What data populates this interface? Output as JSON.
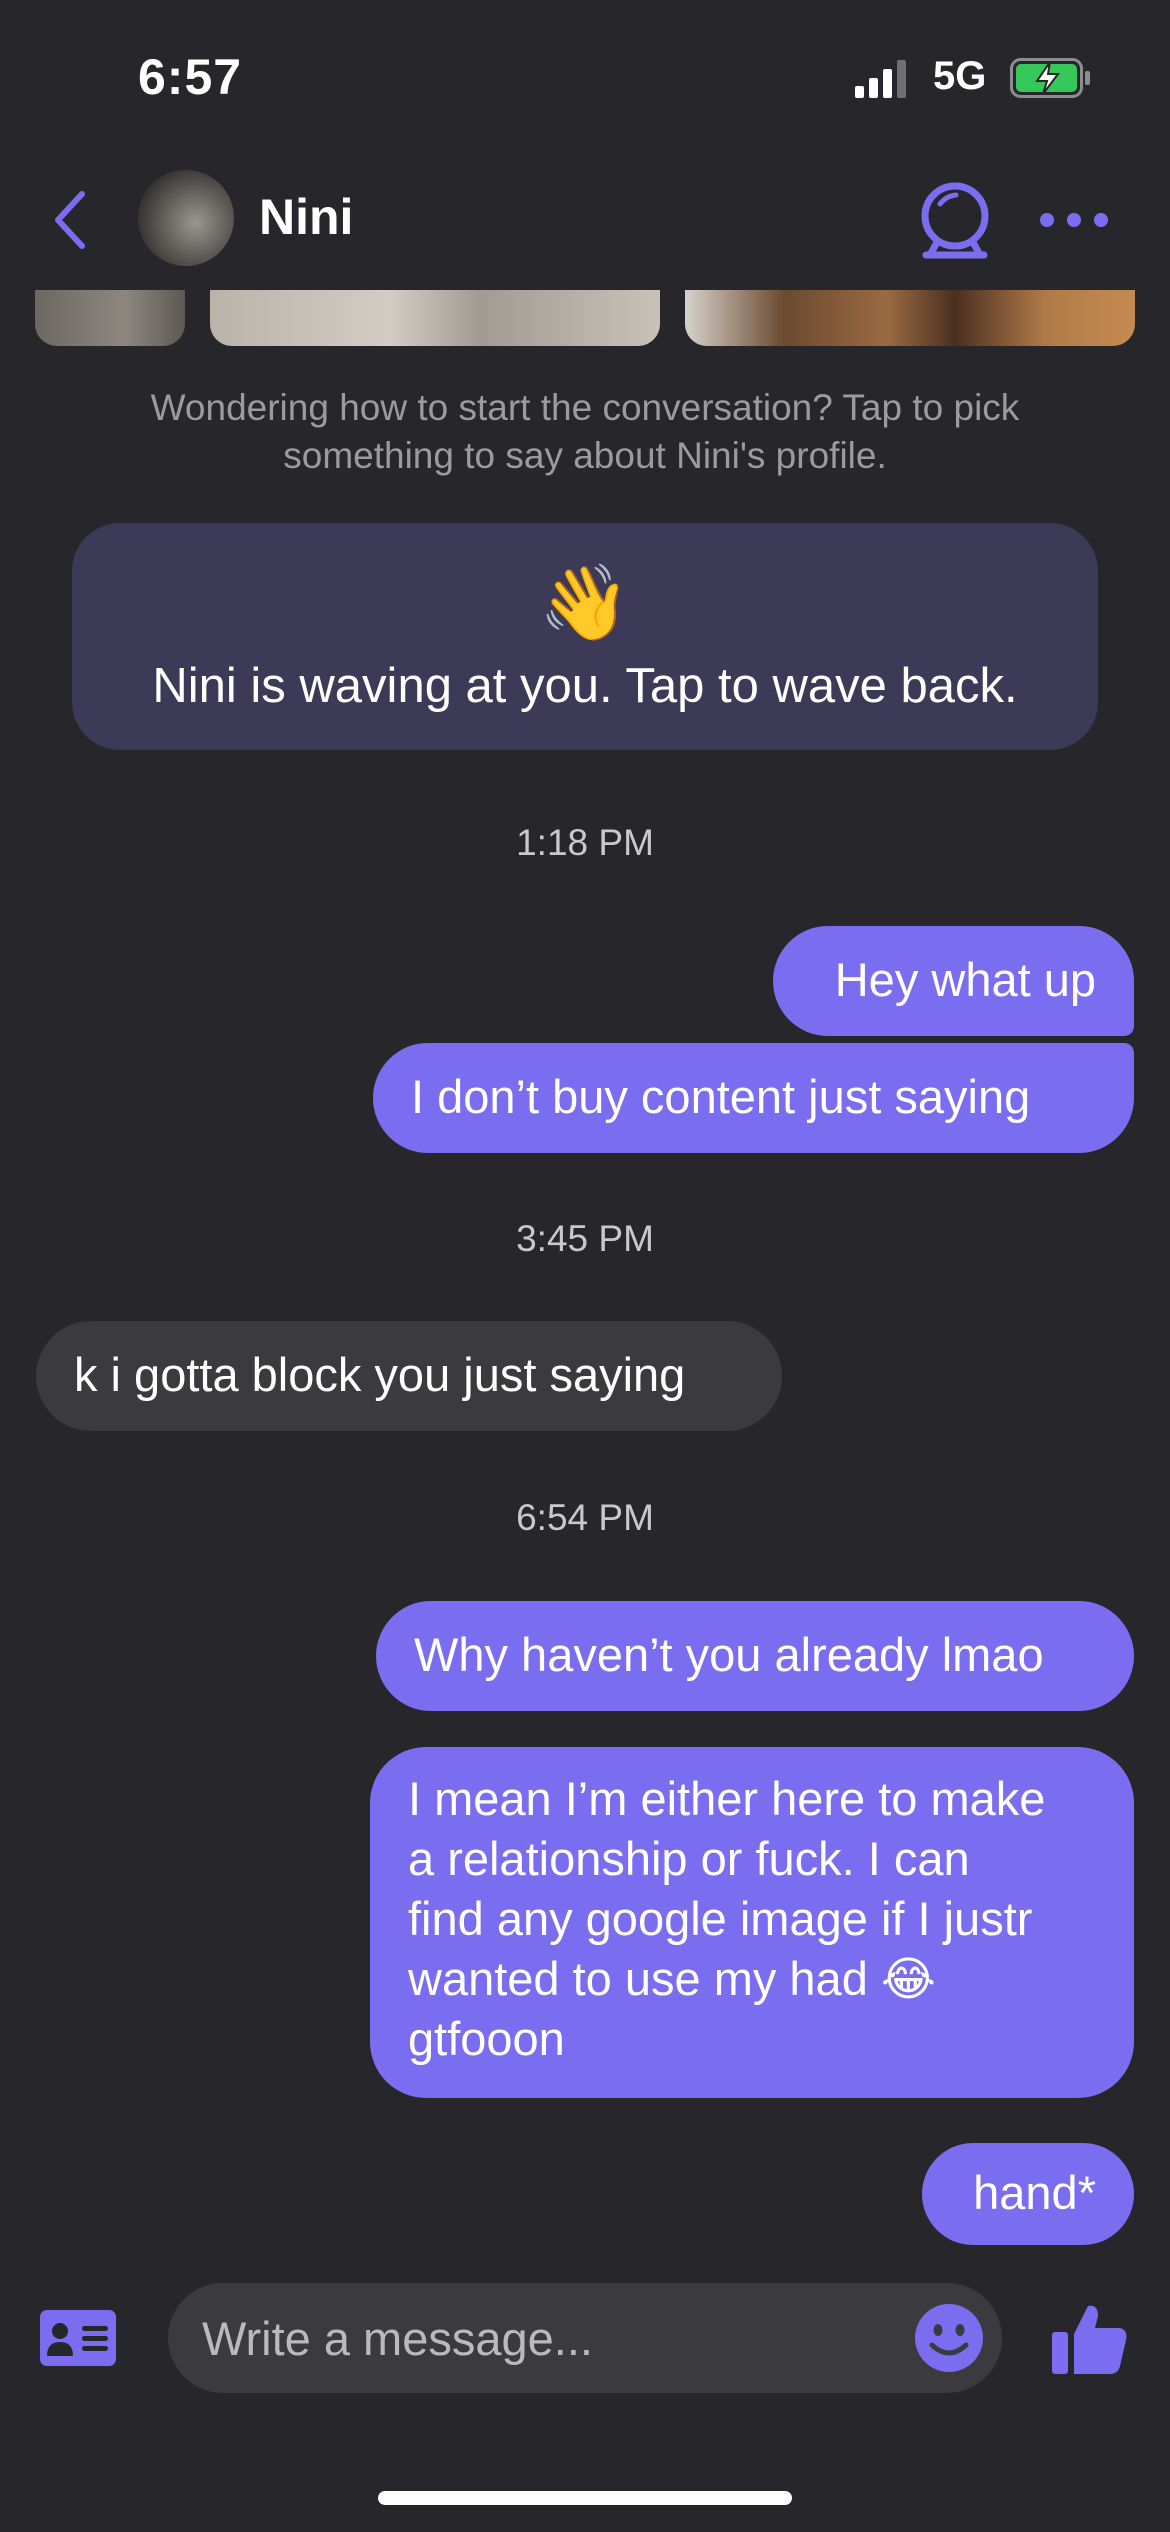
{
  "status_bar": {
    "time": "6:57",
    "network": "5G"
  },
  "header": {
    "contact_name": "Nini"
  },
  "hint_text": "Wondering how to start the conversation? Tap to pick something to say about Nini's profile.",
  "wave_card": {
    "emoji": "👋",
    "text": "Nini is waving at you. Tap to wave back."
  },
  "messages": [
    {
      "type": "timestamp",
      "text": "1:18 PM"
    },
    {
      "type": "outgoing",
      "text": "Hey what up"
    },
    {
      "type": "outgoing",
      "text": "I don’t buy content just saying"
    },
    {
      "type": "timestamp",
      "text": "3:45 PM"
    },
    {
      "type": "incoming",
      "text": "k i gotta block you just saying"
    },
    {
      "type": "timestamp",
      "text": "6:54 PM"
    },
    {
      "type": "outgoing",
      "text": "Why haven’t you already lmao"
    },
    {
      "type": "outgoing",
      "lines": [
        "I mean I’m either here to make",
        "a relationship or fuck. I can",
        "find any google image if I justr",
        "wanted to use my had 😂",
        "gtfooon"
      ]
    },
    {
      "type": "outgoing",
      "text": "hand*"
    }
  ],
  "composer": {
    "placeholder": "Write a message..."
  },
  "colors": {
    "accent": "#7b6df0",
    "background": "#27272b",
    "incoming_bubble": "#3b3b3f",
    "wave_card": "#3c3a56"
  },
  "icons": [
    "back-chevron-icon",
    "profile-card-icon",
    "emoji-smiley-icon",
    "thumbs-up-icon",
    "more-dots-icon",
    "sparkle-ball-icon"
  ]
}
